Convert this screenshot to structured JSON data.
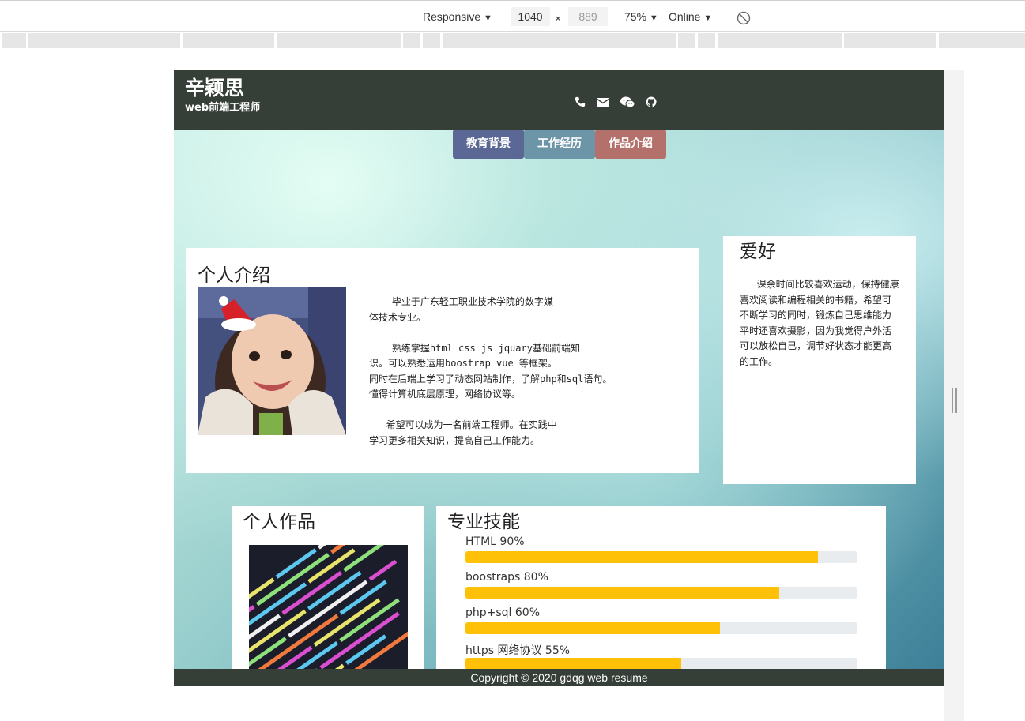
{
  "devtools": {
    "device_label": "Responsive",
    "width_value": "1040",
    "times_sign": "×",
    "height_value": "889",
    "zoom_label": "75%",
    "network_label": "Online",
    "caret": "▼"
  },
  "header": {
    "name": "辛颖思",
    "job_title": "web前端工程师",
    "contact_icons": [
      "phone-icon",
      "envelope-icon",
      "wechat-icon",
      "github-icon"
    ]
  },
  "tabs": [
    {
      "label": "教育背景",
      "color": "#5b6794"
    },
    {
      "label": "工作经历",
      "color": "#6d95a8"
    },
    {
      "label": "作品介绍",
      "color": "#b4706a"
    }
  ],
  "intro": {
    "title": "个人介绍",
    "lines": [
      "    毕业于广东轻工职业技术学院的数字媒",
      "体技术专业。",
      "",
      "    熟练掌握html css js jquary基础前端知",
      "识。可以熟悉运用boostrap vue 等框架。",
      "同时在后端上学习了动态网站制作，了解php和sql语句。",
      "懂得计算机底层原理，网络协议等。",
      "",
      "   希望可以成为一名前端工程师。在实践中",
      "学习更多相关知识，提高自己工作能力。"
    ]
  },
  "hobby": {
    "title": "爱好",
    "lines": [
      "   课余时间比较喜欢运动，保持健康",
      "喜欢阅读和编程相关的书籍，希望可",
      "不断学习的同时，锻炼自己思维能力",
      "平时还喜欢摄影，因为我觉得户外活",
      "可以放松自己，调节好状态才能更高",
      "的工作。"
    ]
  },
  "works": {
    "title": "个人作品"
  },
  "skills": {
    "title": "专业技能",
    "items": [
      {
        "label": "HTML 90%",
        "level": 0.9
      },
      {
        "label": "boostraps 80%",
        "level": 0.8
      },
      {
        "label": "php+sql 60%",
        "level": 0.65
      },
      {
        "label": "https 网络协议 55%",
        "level": 0.55
      }
    ]
  },
  "footer": {
    "text": "Copyright © 2020 gdqg web resume"
  }
}
